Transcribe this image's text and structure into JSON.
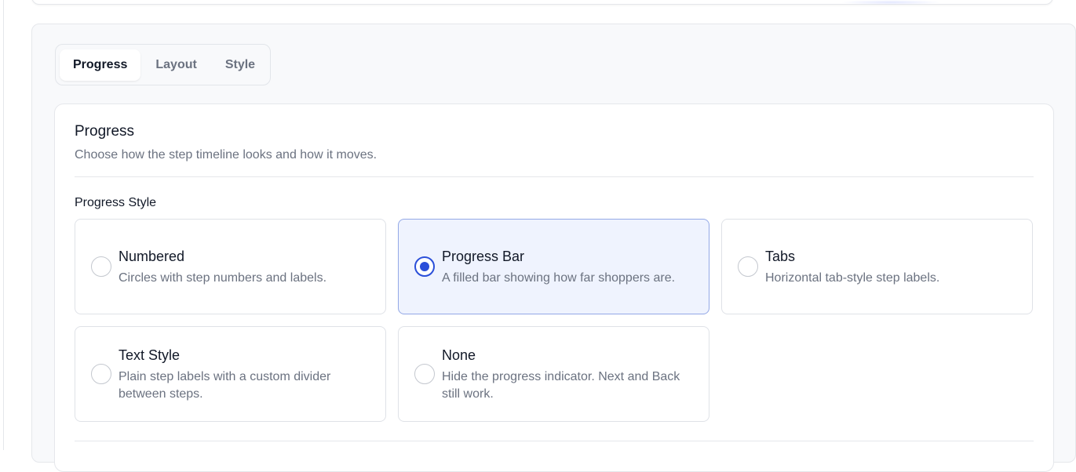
{
  "tabs": [
    {
      "label": "Progress",
      "active": true
    },
    {
      "label": "Layout",
      "active": false
    },
    {
      "label": "Style",
      "active": false
    }
  ],
  "section": {
    "title": "Progress",
    "description": "Choose how the step timeline looks and how it moves."
  },
  "progress_style": {
    "label": "Progress Style",
    "selected": "Progress Bar",
    "options": [
      {
        "title": "Numbered",
        "description": "Circles with step numbers and labels."
      },
      {
        "title": "Progress Bar",
        "description": "A filled bar showing how far shoppers are."
      },
      {
        "title": "Tabs",
        "description": "Horizontal tab-style step labels."
      },
      {
        "title": "Text Style",
        "description": "Plain step labels with a custom divider between steps."
      },
      {
        "title": "None",
        "description": "Hide the progress indicator. Next and Back still work."
      }
    ]
  },
  "colors": {
    "accent": "#2b4fd9",
    "selected_bg": "#eff3fe",
    "selected_border": "#93a8e6"
  }
}
